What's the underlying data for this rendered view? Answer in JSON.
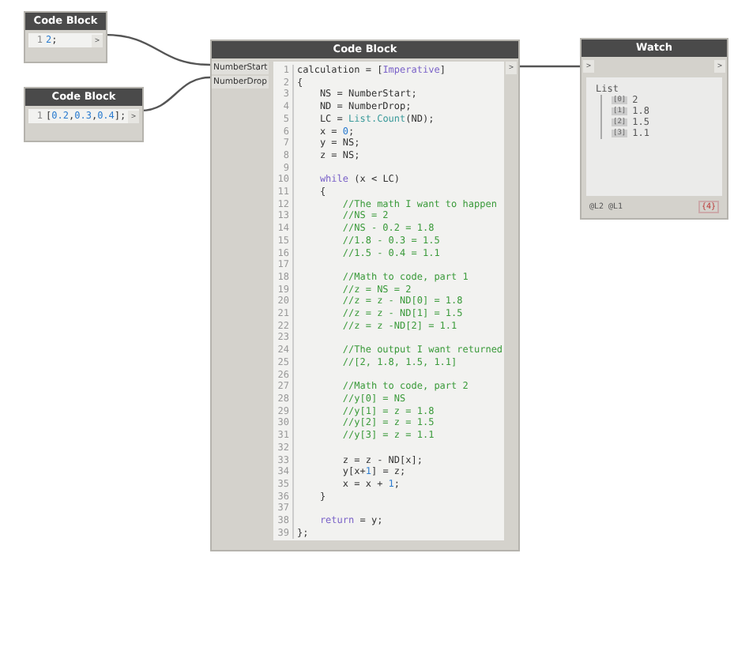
{
  "nodes": [
    {
      "title": "Code Block",
      "lines": [
        {
          "number": "1",
          "segments": [
            {
              "text": "2",
              "kind": "number"
            },
            {
              "text": ";",
              "kind": "plain"
            }
          ]
        }
      ],
      "output": ">"
    },
    {
      "title": "Code Block",
      "lines": [
        {
          "number": "1",
          "segments": [
            {
              "text": "[",
              "kind": "plain"
            },
            {
              "text": "0.2",
              "kind": "number"
            },
            {
              "text": ",",
              "kind": "plain"
            },
            {
              "text": "0.3",
              "kind": "number"
            },
            {
              "text": ",",
              "kind": "plain"
            },
            {
              "text": "0.4",
              "kind": "number"
            },
            {
              "text": "];",
              "kind": "plain"
            }
          ]
        }
      ],
      "output": ">"
    }
  ],
  "main_node": {
    "title": "Code Block",
    "inputs": [
      "NumberStart",
      "NumberDrop"
    ],
    "output": ">",
    "lines": [
      {
        "number": "1",
        "segments": [
          {
            "text": "calculation = [",
            "kind": "plain"
          },
          {
            "text": "Imperative",
            "kind": "keyword"
          },
          {
            "text": "]",
            "kind": "plain"
          }
        ]
      },
      {
        "number": "2",
        "segments": [
          {
            "text": "{",
            "kind": "plain"
          }
        ]
      },
      {
        "number": "3",
        "segments": [
          {
            "text": "    NS = NumberStart;",
            "kind": "plain"
          }
        ]
      },
      {
        "number": "4",
        "segments": [
          {
            "text": "    ND = NumberDrop;",
            "kind": "plain"
          }
        ]
      },
      {
        "number": "5",
        "segments": [
          {
            "text": "    LC = ",
            "kind": "plain"
          },
          {
            "text": "List.Count",
            "kind": "function"
          },
          {
            "text": "(ND);",
            "kind": "plain"
          }
        ]
      },
      {
        "number": "6",
        "segments": [
          {
            "text": "    x = ",
            "kind": "plain"
          },
          {
            "text": "0",
            "kind": "number"
          },
          {
            "text": ";",
            "kind": "plain"
          }
        ]
      },
      {
        "number": "7",
        "segments": [
          {
            "text": "    y = NS;",
            "kind": "plain"
          }
        ]
      },
      {
        "number": "8",
        "segments": [
          {
            "text": "    z = NS;",
            "kind": "plain"
          }
        ]
      },
      {
        "number": "9"
      },
      {
        "number": "10",
        "segments": [
          {
            "text": "    while",
            "kind": "keyword"
          },
          {
            "text": " (x < LC)",
            "kind": "plain"
          }
        ]
      },
      {
        "number": "11",
        "segments": [
          {
            "text": "    {",
            "kind": "plain"
          }
        ]
      },
      {
        "number": "12",
        "segments": [
          {
            "text": "        //The math I want to happen",
            "kind": "comment"
          }
        ]
      },
      {
        "number": "13",
        "segments": [
          {
            "text": "        //NS = 2",
            "kind": "comment"
          }
        ]
      },
      {
        "number": "14",
        "segments": [
          {
            "text": "        //NS - 0.2 = 1.8",
            "kind": "comment"
          }
        ]
      },
      {
        "number": "15",
        "segments": [
          {
            "text": "        //1.8 - 0.3 = 1.5",
            "kind": "comment"
          }
        ]
      },
      {
        "number": "16",
        "segments": [
          {
            "text": "        //1.5 - 0.4 = 1.1",
            "kind": "comment"
          }
        ]
      },
      {
        "number": "17"
      },
      {
        "number": "18",
        "segments": [
          {
            "text": "        //Math to code, part 1",
            "kind": "comment"
          }
        ]
      },
      {
        "number": "19",
        "segments": [
          {
            "text": "        //z = NS = 2",
            "kind": "comment"
          }
        ]
      },
      {
        "number": "20",
        "segments": [
          {
            "text": "        //z = z - ND[0] = 1.8",
            "kind": "comment"
          }
        ]
      },
      {
        "number": "21",
        "segments": [
          {
            "text": "        //z = z - ND[1] = 1.5",
            "kind": "comment"
          }
        ]
      },
      {
        "number": "22",
        "segments": [
          {
            "text": "        //z = z -ND[2] = 1.1",
            "kind": "comment"
          }
        ]
      },
      {
        "number": "23"
      },
      {
        "number": "24",
        "segments": [
          {
            "text": "        //The output I want returned",
            "kind": "comment"
          }
        ]
      },
      {
        "number": "25",
        "segments": [
          {
            "text": "        //[2, 1.8, 1.5, 1.1]",
            "kind": "comment"
          }
        ]
      },
      {
        "number": "26"
      },
      {
        "number": "27",
        "segments": [
          {
            "text": "        //Math to code, part 2",
            "kind": "comment"
          }
        ]
      },
      {
        "number": "28",
        "segments": [
          {
            "text": "        //y[0] = NS",
            "kind": "comment"
          }
        ]
      },
      {
        "number": "29",
        "segments": [
          {
            "text": "        //y[1] = z = 1.8",
            "kind": "comment"
          }
        ]
      },
      {
        "number": "30",
        "segments": [
          {
            "text": "        //y[2] = z = 1.5",
            "kind": "comment"
          }
        ]
      },
      {
        "number": "31",
        "segments": [
          {
            "text": "        //y[3] = z = 1.1",
            "kind": "comment"
          }
        ]
      },
      {
        "number": "32"
      },
      {
        "number": "33",
        "segments": [
          {
            "text": "        z = z - ND[x];",
            "kind": "plain"
          }
        ]
      },
      {
        "number": "34",
        "segments": [
          {
            "text": "        y[x+",
            "kind": "plain"
          },
          {
            "text": "1",
            "kind": "number"
          },
          {
            "text": "] = z;",
            "kind": "plain"
          }
        ]
      },
      {
        "number": "35",
        "segments": [
          {
            "text": "        x = x + ",
            "kind": "plain"
          },
          {
            "text": "1",
            "kind": "number"
          },
          {
            "text": ";",
            "kind": "plain"
          }
        ]
      },
      {
        "number": "36",
        "segments": [
          {
            "text": "    }",
            "kind": "plain"
          }
        ]
      },
      {
        "number": "37"
      },
      {
        "number": "38",
        "segments": [
          {
            "text": "    return",
            "kind": "keyword"
          },
          {
            "text": " = y;",
            "kind": "plain"
          }
        ]
      },
      {
        "number": "39",
        "segments": [
          {
            "text": "};",
            "kind": "plain"
          }
        ]
      }
    ]
  },
  "watch": {
    "title": "Watch",
    "input": ">",
    "output": ">",
    "list_label": "List",
    "items": [
      {
        "index": "[0]",
        "value": "2"
      },
      {
        "index": "[1]",
        "value": "1.8"
      },
      {
        "index": "[2]",
        "value": "1.5"
      },
      {
        "index": "[3]",
        "value": "1.1"
      }
    ],
    "levels": "@L2 @L1",
    "count": "{4}"
  }
}
